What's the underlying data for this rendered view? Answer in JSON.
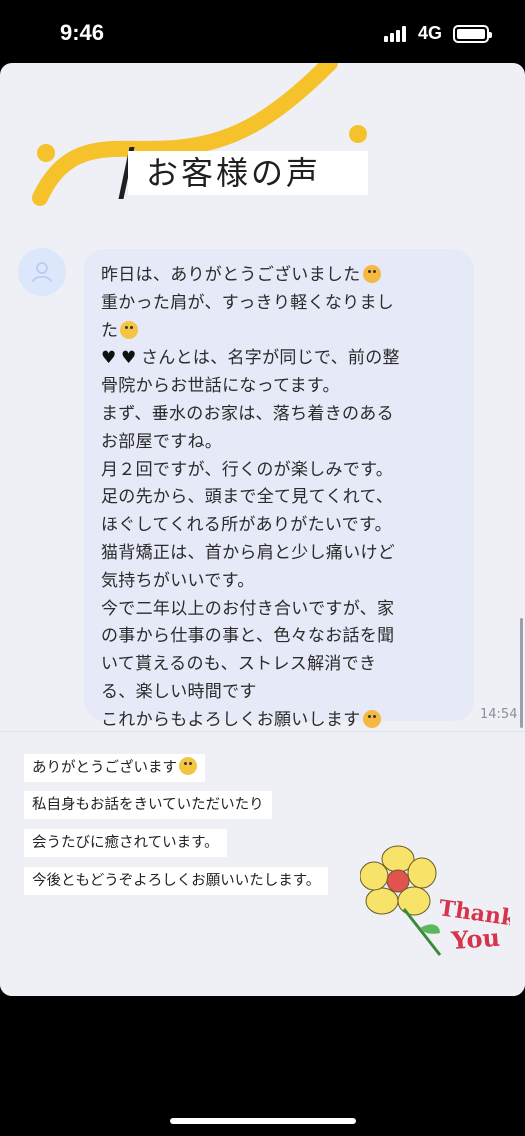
{
  "status_bar": {
    "time": "9:46",
    "network": "4G"
  },
  "header": {
    "title": "お客様の声"
  },
  "message": {
    "lines": [
      "昨日は、ありがとうございました",
      "重かった肩が、すっきり軽くなりまし",
      "た",
      "さんとは、名字が同じで、前の整",
      "骨院からお世話になってます。",
      "まず、垂水のお家は、落ち着きのある",
      "お部屋ですね。",
      "月２回ですが、行くのが楽しみです。",
      "足の先から、頭まで全て見てくれて、",
      "ほぐしてくれる所がありがたいです。",
      "猫背矯正は、首から肩と少し痛いけど",
      "気持ちがいいです。",
      "今で二年以上のお付き合いですが、家",
      "の事から仕事の事と、色々なお話を聞",
      "いて貰えるのも、ストレス解消でき",
      "る、楽しい時間です",
      "これからもよろしくお願いします"
    ],
    "time": "14:54"
  },
  "reply": {
    "lines": [
      "ありがとうございます",
      "私自身もお話をきいていただいたり",
      "会うたびに癒されています。",
      "今後ともどうぞよろしくお願いいたします。"
    ]
  },
  "thanks_art": {
    "text_line1": "Thank",
    "text_line2": "You"
  },
  "colors": {
    "accent_yellow": "#f5c22b",
    "bubble": "#e6e9f8",
    "background": "#eef0f5"
  }
}
